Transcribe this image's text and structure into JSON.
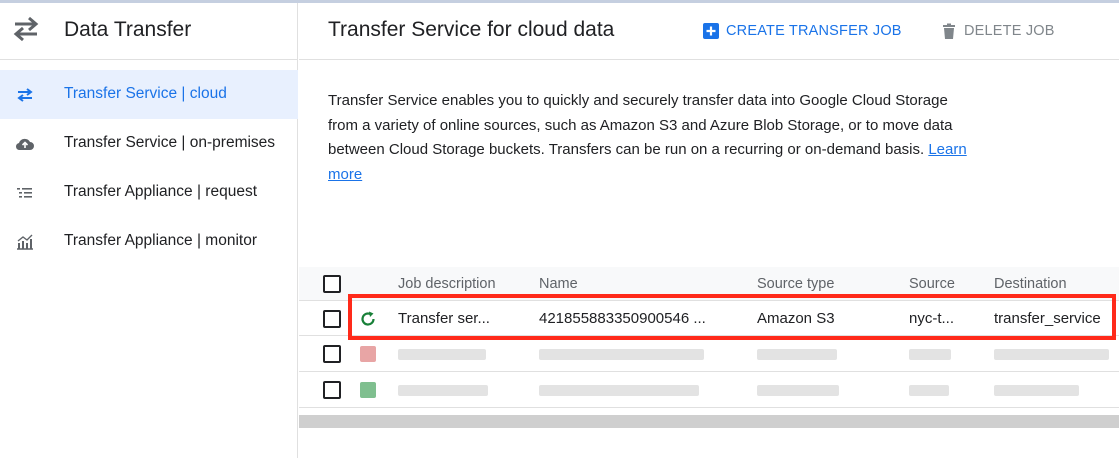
{
  "sidebar": {
    "title": "Data Transfer",
    "items": [
      {
        "label": "Transfer Service | cloud",
        "icon": "swap-arrows-icon",
        "active": true
      },
      {
        "label": "Transfer Service | on-premises",
        "icon": "cloud-upload-icon",
        "active": false
      },
      {
        "label": "Transfer Appliance | request",
        "icon": "list-icon",
        "active": false
      },
      {
        "label": "Transfer Appliance | monitor",
        "icon": "chart-icon",
        "active": false
      }
    ]
  },
  "header": {
    "title": "Transfer Service for cloud data",
    "create_label": "CREATE TRANSFER JOB",
    "delete_label": "DELETE JOB"
  },
  "intro": {
    "text": "Transfer Service enables you to quickly and securely transfer data into Google Cloud Storage from a variety of online sources, such as Amazon S3 and Azure Blob Storage, or to move data between Cloud Storage buckets. Transfers can be run on a recurring or on-demand basis.",
    "link": "Learn more"
  },
  "table": {
    "columns": [
      "Job description",
      "Name",
      "Source type",
      "Source",
      "Destination"
    ],
    "rows": [
      {
        "description": "Transfer ser...",
        "name": "421855883350900546 ...",
        "source_type": "Amazon S3",
        "source": "nyc-t...",
        "destination": "transfer_service",
        "status": "running"
      }
    ]
  },
  "colors": {
    "accent": "#1a73e8",
    "active_bg": "#e8f0fe",
    "highlight": "#ff2a1a",
    "running": "#188038"
  }
}
